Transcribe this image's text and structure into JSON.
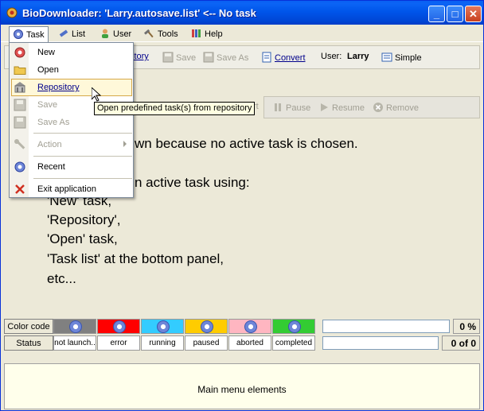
{
  "window": {
    "title": "BioDownloader: 'Larry.autosave.list' <-- No task"
  },
  "menubar": {
    "items": [
      {
        "label": "Task",
        "icon": "gear-icon"
      },
      {
        "label": "List",
        "icon": "tools-icon"
      },
      {
        "label": "User",
        "icon": "user-icon"
      },
      {
        "label": "Tools",
        "icon": "hammer-icon"
      },
      {
        "label": "Help",
        "icon": "books-icon"
      }
    ]
  },
  "toolbar": {
    "repository_fragment": "itory",
    "save": "Save",
    "save_as": "Save As",
    "convert": "Convert",
    "user_label": "User:",
    "user_value": "Larry",
    "simple": "Simple"
  },
  "taskbar": {
    "start_fragment": "rt",
    "pause": "Pause",
    "resume": "Resume",
    "remove": "Remove"
  },
  "message": {
    "line1": "wn because no active task is chosen.",
    "line2": "n active task using:",
    "line3": "'New' task,",
    "line4": "'Repository',",
    "line5": "'Open' task,",
    "line6": "'Task list' at the bottom panel,",
    "line7": "etc..."
  },
  "status": {
    "color_code_label": "Color code",
    "status_label": "Status",
    "states": [
      {
        "label": "not launch..",
        "color": "#808080"
      },
      {
        "label": "error",
        "color": "#ff0000"
      },
      {
        "label": "running",
        "color": "#33ccff"
      },
      {
        "label": "paused",
        "color": "#ffcc00"
      },
      {
        "label": "aborted",
        "color": "#ffb6c1"
      },
      {
        "label": "completed",
        "color": "#33cc33"
      }
    ],
    "percent": "0 %",
    "count": "0 of 0"
  },
  "bottom_panel": {
    "label": "Main menu elements"
  },
  "dropdown": {
    "items": [
      {
        "label": "New",
        "icon": "new-task-icon",
        "enabled": true
      },
      {
        "label": "Open",
        "icon": "folder-icon",
        "enabled": true
      },
      {
        "label": "Repository",
        "icon": "repository-icon",
        "enabled": true
      },
      {
        "label": "Save",
        "icon": "save-icon",
        "enabled": false
      },
      {
        "label": "Save As",
        "icon": "save-as-icon",
        "enabled": false
      },
      {
        "label": "Action",
        "icon": "wrench-icon",
        "enabled": false
      },
      {
        "label": "Recent",
        "icon": "gear-icon",
        "enabled": true
      },
      {
        "label": "Exit application",
        "icon": "close-icon",
        "enabled": true
      }
    ]
  },
  "tooltip": {
    "text": "Open predefined task(s) from repository"
  }
}
